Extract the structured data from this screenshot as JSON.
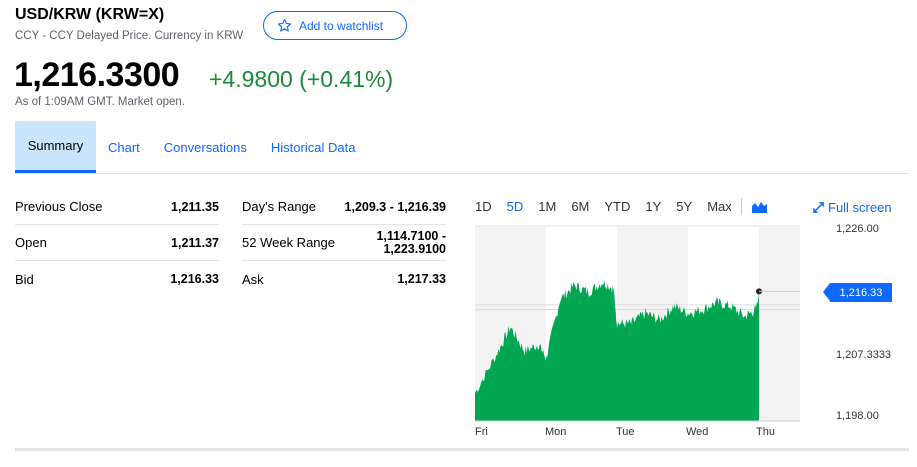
{
  "header": {
    "title": "USD/KRW (KRW=X)",
    "subtitle": "CCY - CCY Delayed Price. Currency in KRW",
    "watchlist_label": "Add to watchlist"
  },
  "quote": {
    "price": "1,216.3300",
    "change": "+4.9800 (+0.41%)",
    "as_of": "As of 1:09AM GMT. Market open."
  },
  "tabs": [
    {
      "label": "Summary",
      "active": true
    },
    {
      "label": "Chart"
    },
    {
      "label": "Conversations"
    },
    {
      "label": "Historical Data"
    }
  ],
  "stats_left": [
    {
      "label": "Previous Close",
      "value": "1,211.35"
    },
    {
      "label": "Open",
      "value": "1,211.37"
    },
    {
      "label": "Bid",
      "value": "1,216.33"
    }
  ],
  "stats_right": [
    {
      "label": "Day's Range",
      "value": "1,209.3 - 1,216.39"
    },
    {
      "label": "52 Week Range",
      "value_line1": "1,114.7100 -",
      "value_line2": "1,223.9100"
    },
    {
      "label": "Ask",
      "value": "1,217.33"
    }
  ],
  "chart_controls": {
    "ranges": [
      "1D",
      "5D",
      "1M",
      "6M",
      "YTD",
      "1Y",
      "5Y",
      "Max"
    ],
    "active_range": "5D",
    "fullscreen_label": "Full screen",
    "chart_type_icon": "mountain-chart-icon"
  },
  "colors": {
    "accent": "#0f69ff",
    "positive": "#1a8a3a",
    "area_fill": "#00a651",
    "tab_active_bg": "#c9e4fb"
  },
  "chart_data": {
    "type": "area",
    "title": "",
    "xlabel": "",
    "ylabel": "",
    "categories": [
      "Fri",
      "Mon",
      "Tue",
      "Wed",
      "Thu"
    ],
    "y_tick_labels": [
      "1,226.00",
      "1,207.3333",
      "1,198.00"
    ],
    "ylim": [
      1198.0,
      1226.0
    ],
    "current_price_label": "1,216.33",
    "grid": true,
    "series": [
      {
        "x": [
          0,
          0.3,
          0.5,
          0.7,
          0.9,
          1.0,
          1.2,
          1.4,
          1.6,
          1.8,
          1.95,
          2.0,
          2.2,
          2.4,
          2.6,
          2.8,
          3.0,
          3.2,
          3.4,
          3.6,
          3.8,
          3.95,
          4.0
        ],
        "values": [
          1202.0,
          1207.5,
          1211.5,
          1208.0,
          1209.0,
          1207.0,
          1215.5,
          1217.5,
          1216.5,
          1218.0,
          1217.0,
          1212.0,
          1212.0,
          1213.5,
          1212.5,
          1214.5,
          1213.5,
          1214.0,
          1215.0,
          1214.5,
          1213.0,
          1214.0,
          1216.33
        ]
      }
    ]
  }
}
